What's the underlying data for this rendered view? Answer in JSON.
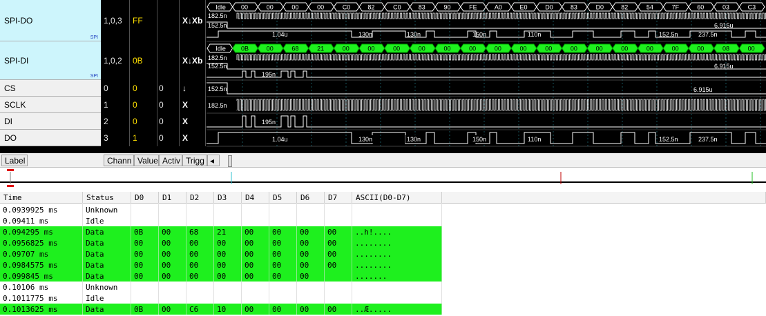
{
  "channels": [
    {
      "label": "SPI-DO",
      "tag": "SPI",
      "channel": "1,0,3",
      "value": "FF",
      "active": "",
      "trigger": "X↓Xb",
      "bus": true
    },
    {
      "label": "SPI-DI",
      "tag": "SPI",
      "channel": "1,0,2",
      "value": "0B",
      "active": "",
      "trigger": "X↓Xb",
      "bus": true
    },
    {
      "label": "CS",
      "channel": "0",
      "value": "0",
      "active": "0",
      "trigger": "↓",
      "bus": false
    },
    {
      "label": "SCLK",
      "channel": "1",
      "value": "0",
      "active": "0",
      "trigger": "X",
      "bus": false
    },
    {
      "label": "DI",
      "channel": "2",
      "value": "0",
      "active": "0",
      "trigger": "X",
      "bus": false
    },
    {
      "label": "DO",
      "channel": "3",
      "value": "1",
      "active": "0",
      "trigger": "X",
      "bus": false
    }
  ],
  "headers": {
    "label": "Label",
    "channel": "Chann",
    "value": "Value",
    "active": "Activ",
    "trigger": "Trigg",
    "scroll_left": "◂"
  },
  "wave": {
    "do_bus": [
      "Idle",
      "00",
      "00",
      "00",
      "00",
      "C0",
      "82",
      "C0",
      "83",
      "90",
      "FE",
      "A0",
      "E0",
      "D0",
      "83",
      "D0",
      "82",
      "54",
      "7F",
      "60",
      "03",
      "C3"
    ],
    "di_bus": [
      "Idle",
      "0B",
      "00",
      "68",
      "21",
      "00",
      "00",
      "00",
      "00",
      "00",
      "00",
      "00",
      "00",
      "00",
      "00",
      "00",
      "00",
      "00",
      "00",
      "00",
      "08",
      "00"
    ],
    "do_bus_meas": [
      "182.5n",
      "152.5n",
      "6.915u"
    ],
    "do_bus_pulses": [
      "1.04u",
      "130n",
      "130n",
      "150n",
      "110n",
      "152.5n",
      "237.5n"
    ],
    "di_bus_meas": [
      "182.5n",
      "152.5n",
      "6.915u"
    ],
    "di_bus_pulses": [
      "195n"
    ],
    "cs_meas": [
      "152.5n",
      "6.915u"
    ],
    "sclk_meas": [
      "182.5n"
    ],
    "di_meas": [
      "195n"
    ],
    "do_meas": [
      "1.04u",
      "130n",
      "130n",
      "150n",
      "110n",
      "152.5n",
      "237.5n"
    ]
  },
  "table": {
    "columns": [
      "Time",
      "Status",
      "D0",
      "D1",
      "D2",
      "D3",
      "D4",
      "D5",
      "D6",
      "D7",
      "ASCII(D0-D7)"
    ],
    "rows": [
      {
        "time": "0.0939925 ms",
        "status": "Unknown",
        "d": [
          "",
          "",
          "",
          "",
          "",
          "",
          "",
          ""
        ],
        "ascii": "",
        "green": false
      },
      {
        "time": "0.09411 ms",
        "status": "Idle",
        "d": [
          "",
          "",
          "",
          "",
          "",
          "",
          "",
          ""
        ],
        "ascii": "",
        "green": false
      },
      {
        "time": "0.094295 ms",
        "status": "Data",
        "d": [
          "0B",
          "00",
          "68",
          "21",
          "00",
          "00",
          "00",
          "00"
        ],
        "ascii": "..h!....",
        "green": true
      },
      {
        "time": "0.0956825 ms",
        "status": "Data",
        "d": [
          "00",
          "00",
          "00",
          "00",
          "00",
          "00",
          "00",
          "00"
        ],
        "ascii": "........",
        "green": true
      },
      {
        "time": "0.09707 ms",
        "status": "Data",
        "d": [
          "00",
          "00",
          "00",
          "00",
          "00",
          "00",
          "00",
          "00"
        ],
        "ascii": "........",
        "green": true
      },
      {
        "time": "0.0984575 ms",
        "status": "Data",
        "d": [
          "00",
          "00",
          "00",
          "00",
          "00",
          "00",
          "00",
          "00"
        ],
        "ascii": "........",
        "green": true
      },
      {
        "time": "0.099845 ms",
        "status": "Data",
        "d": [
          "00",
          "00",
          "00",
          "00",
          "00",
          "00",
          "00",
          ""
        ],
        "ascii": ".......",
        "green": true
      },
      {
        "time": "0.10106 ms",
        "status": "Unknown",
        "d": [
          "",
          "",
          "",
          "",
          "",
          "",
          "",
          ""
        ],
        "ascii": "",
        "green": false
      },
      {
        "time": "0.1011775 ms",
        "status": "Idle",
        "d": [
          "",
          "",
          "",
          "",
          "",
          "",
          "",
          ""
        ],
        "ascii": "",
        "green": false
      },
      {
        "time": "0.1013625 ms",
        "status": "Data",
        "d": [
          "0B",
          "00",
          "C6",
          "10",
          "00",
          "00",
          "00",
          "00"
        ],
        "ascii": "..Æ.....",
        "green": true
      }
    ]
  },
  "colors": {
    "green": "#1ef01e",
    "bus_label_bg": "#cdf5fc",
    "value_yellow": "#ffe000"
  }
}
